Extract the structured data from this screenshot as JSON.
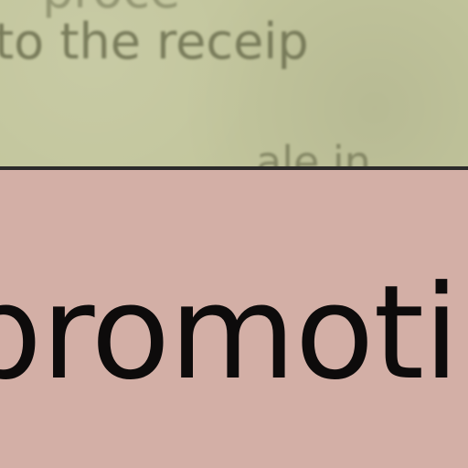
{
  "paper_fragment": {
    "line1": "proce",
    "line2": "to the receip",
    "line3": "ale in"
  },
  "main_word": "promotin",
  "colors": {
    "paper": "#c3c69d",
    "paper_text": "#6c6f4f",
    "divider": "#2b2a2a",
    "panel": "#d3afa6",
    "word": "#0d0b0b"
  }
}
